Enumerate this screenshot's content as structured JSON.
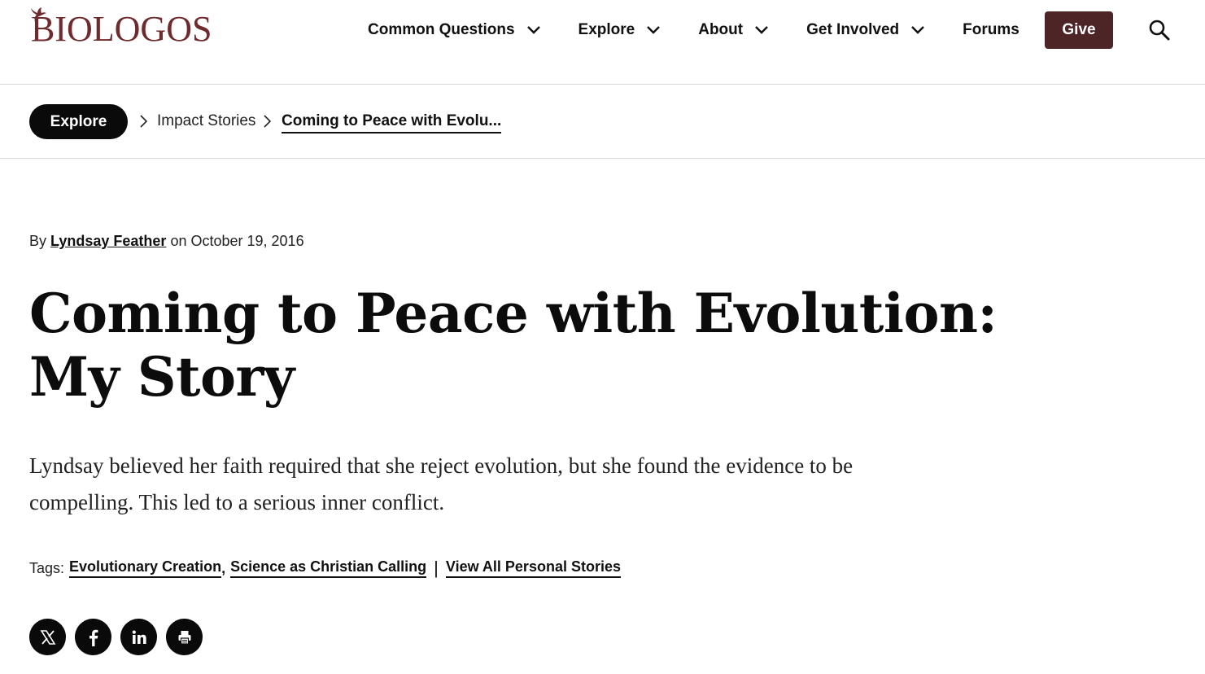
{
  "brand": {
    "logo_text": "BIOLOGOS",
    "color": "#6e2a2c"
  },
  "nav": {
    "items": [
      {
        "label": "Common Questions",
        "has_dropdown": true
      },
      {
        "label": "Explore",
        "has_dropdown": true
      },
      {
        "label": "About",
        "has_dropdown": true
      },
      {
        "label": "Get Involved",
        "has_dropdown": true
      },
      {
        "label": "Forums",
        "has_dropdown": false
      }
    ],
    "give_label": "Give",
    "give_color": "#4e2526"
  },
  "breadcrumb": {
    "root": "Explore",
    "section": "Impact Stories",
    "current": "Coming to Peace with Evolu..."
  },
  "article": {
    "byline_prefix": "By",
    "author": "Lyndsay Feather",
    "date_prefix": "on",
    "date": "October 19, 2016",
    "title": "Coming to Peace with Evolution: My Story",
    "dek": "Lyndsay believed her faith required that she reject evolution, but she found the evidence to be compelling. This led to a serious inner conflict.",
    "tags_label": "Tags:",
    "tags": [
      "Evolutionary Creation",
      "Science as Christian Calling"
    ],
    "tag_separator": ",",
    "divider": "|",
    "view_all": "View All Personal Stories"
  },
  "share": {
    "buttons": [
      "x-icon",
      "facebook-icon",
      "linkedin-icon",
      "print-icon"
    ]
  }
}
